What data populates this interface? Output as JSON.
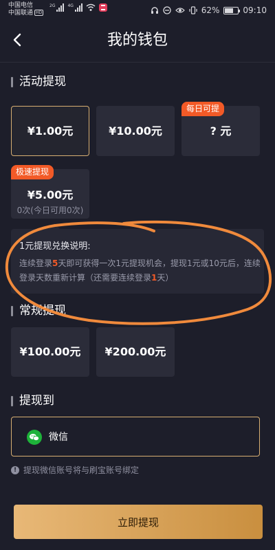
{
  "status_bar": {
    "carrier_1": "中国电信",
    "carrier_2": "中国联通",
    "hd": "HD",
    "net_1": "2G",
    "net_2": "4G",
    "battery": "62%",
    "time": "09:10"
  },
  "header": {
    "title": "我的钱包"
  },
  "activity": {
    "section_title": "活动提现",
    "cards": [
      {
        "amount": "¥1.00元",
        "selected": true
      },
      {
        "amount": "¥10.00元"
      },
      {
        "amount": "? 元",
        "badge": "每日可提"
      },
      {
        "amount": "¥5.00元",
        "badge": "极速提现",
        "sub": "0次(今日可用0次)"
      }
    ]
  },
  "info": {
    "title": "1元提现兑换说明:",
    "text_parts": [
      "连续登录",
      "5",
      "天即可获得一次1元提现机会，提现1元或10元后，连续登录天数重新计算（还需要连续登录",
      "1",
      "天）"
    ]
  },
  "regular": {
    "section_title": "常规提现",
    "cards": [
      {
        "amount": "¥100.00元"
      },
      {
        "amount": "¥200.00元"
      }
    ]
  },
  "withdraw_to": {
    "section_title": "提现到",
    "method": "微信",
    "notice": "提现微信账号将与刷宝账号绑定"
  },
  "submit": {
    "label": "立即提现"
  },
  "colors": {
    "accent": "#d9b073",
    "badge": "#f25a27",
    "background": "#1d1e2a",
    "card": "#2b2c39",
    "wechat": "#1eb23a"
  }
}
